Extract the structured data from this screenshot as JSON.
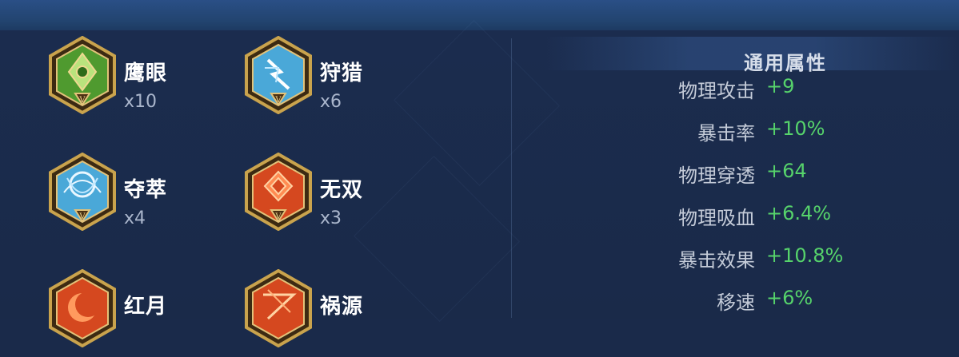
{
  "runes": [
    {
      "name": "鹰眼",
      "count": "x10",
      "icon": "hawk-eye-rune-icon",
      "color": "#4f9a2f"
    },
    {
      "name": "狩猎",
      "count": "x6",
      "icon": "hunt-rune-icon",
      "color": "#4aa8d8"
    },
    {
      "name": "夺萃",
      "count": "x4",
      "icon": "seize-rune-icon",
      "color": "#4aa8d8"
    },
    {
      "name": "无双",
      "count": "x3",
      "icon": "peerless-rune-icon",
      "color": "#d5481f"
    },
    {
      "name": "红月",
      "count": "",
      "icon": "red-moon-rune-icon",
      "color": "#d5481f"
    },
    {
      "name": "祸源",
      "count": "",
      "icon": "calamity-rune-icon",
      "color": "#d5481f"
    }
  ],
  "attributes": {
    "title": "通用属性",
    "rows": [
      {
        "label": "物理攻击",
        "value": "+9"
      },
      {
        "label": "暴击率",
        "value": "+10%"
      },
      {
        "label": "物理穿透",
        "value": "+64"
      },
      {
        "label": "物理吸血",
        "value": "+6.4%"
      },
      {
        "label": "暴击效果",
        "value": "+10.8%"
      },
      {
        "label": "移速",
        "value": "+6%"
      }
    ]
  },
  "colors": {
    "positive_value": "#56d36b",
    "background": "#1a2a4a",
    "gold_frame": "#c9a34d"
  }
}
